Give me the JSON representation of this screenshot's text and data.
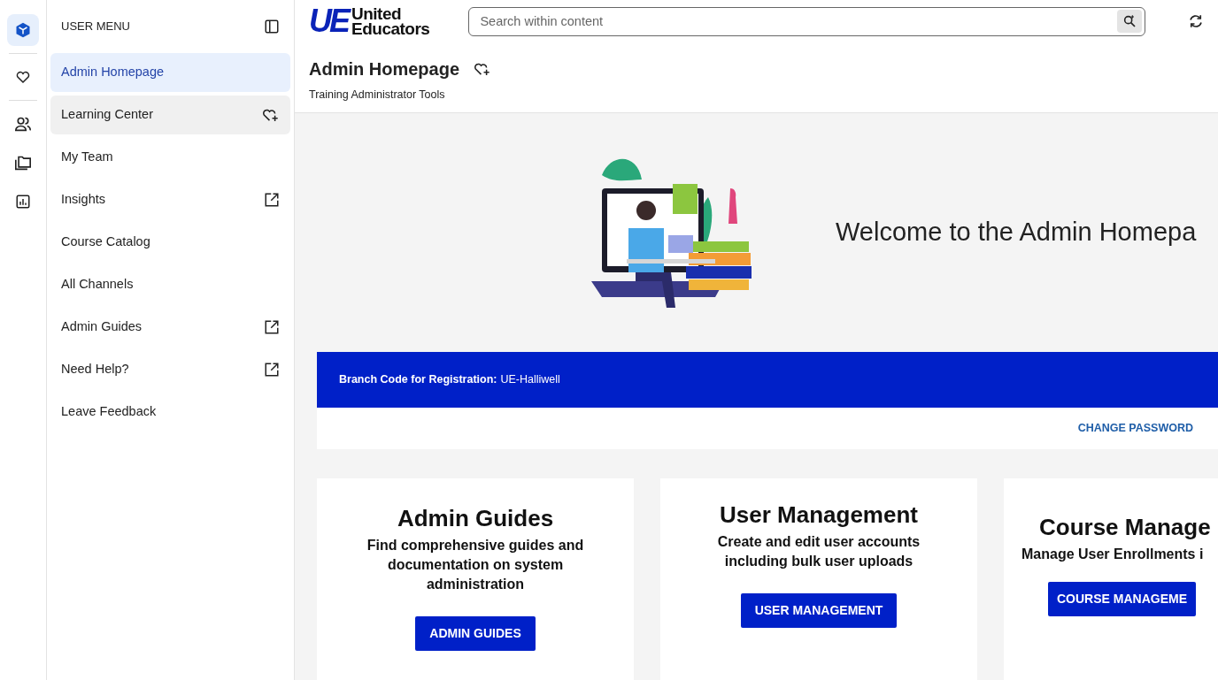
{
  "rail": [
    {
      "kind": "cube",
      "selected": true
    },
    {
      "kind": "heart",
      "selected": false
    },
    {
      "kind": "people",
      "selected": false
    },
    {
      "kind": "folders",
      "selected": false
    },
    {
      "kind": "chart",
      "selected": false
    }
  ],
  "sidebar": {
    "title": "USER MENU",
    "items": [
      {
        "label": "Admin Homepage",
        "selected": true,
        "hovered": false,
        "kind": "plain"
      },
      {
        "label": "Learning Center",
        "selected": false,
        "hovered": true,
        "kind": "favorite"
      },
      {
        "label": "My Team",
        "selected": false,
        "hovered": false,
        "kind": "plain"
      },
      {
        "label": "Insights",
        "selected": false,
        "hovered": false,
        "kind": "external"
      },
      {
        "label": "Course Catalog",
        "selected": false,
        "hovered": false,
        "kind": "plain"
      },
      {
        "label": "All Channels",
        "selected": false,
        "hovered": false,
        "kind": "plain"
      },
      {
        "label": "Admin Guides",
        "selected": false,
        "hovered": false,
        "kind": "external"
      },
      {
        "label": "Need Help?",
        "selected": false,
        "hovered": false,
        "kind": "external"
      },
      {
        "label": "Leave Feedback",
        "selected": false,
        "hovered": false,
        "kind": "plain"
      }
    ]
  },
  "header": {
    "logo": {
      "mark": "UE",
      "line_1": "United",
      "line_2": "Educators"
    },
    "search": {
      "placeholder": "Search within content"
    }
  },
  "page": {
    "title": "Admin Homepage",
    "subtitle": "Training Administrator Tools"
  },
  "hero": {
    "welcome": "Welcome to the Admin Homepa"
  },
  "branch": {
    "label": "Branch Code for Registration:",
    "value": "UE-Halliwell"
  },
  "change_password": "CHANGE PASSWORD",
  "cards": [
    {
      "title": "Admin Guides",
      "description": "Find comprehensive guides and documentation on system administration",
      "button": "ADMIN GUIDES"
    },
    {
      "title": "User Management",
      "description": "Create and edit user accounts including bulk user uploads",
      "button": "USER MANAGEMENT"
    },
    {
      "title": "Course Manage",
      "description": "Manage User Enrollments i",
      "button": "COURSE MANAGEME"
    }
  ]
}
